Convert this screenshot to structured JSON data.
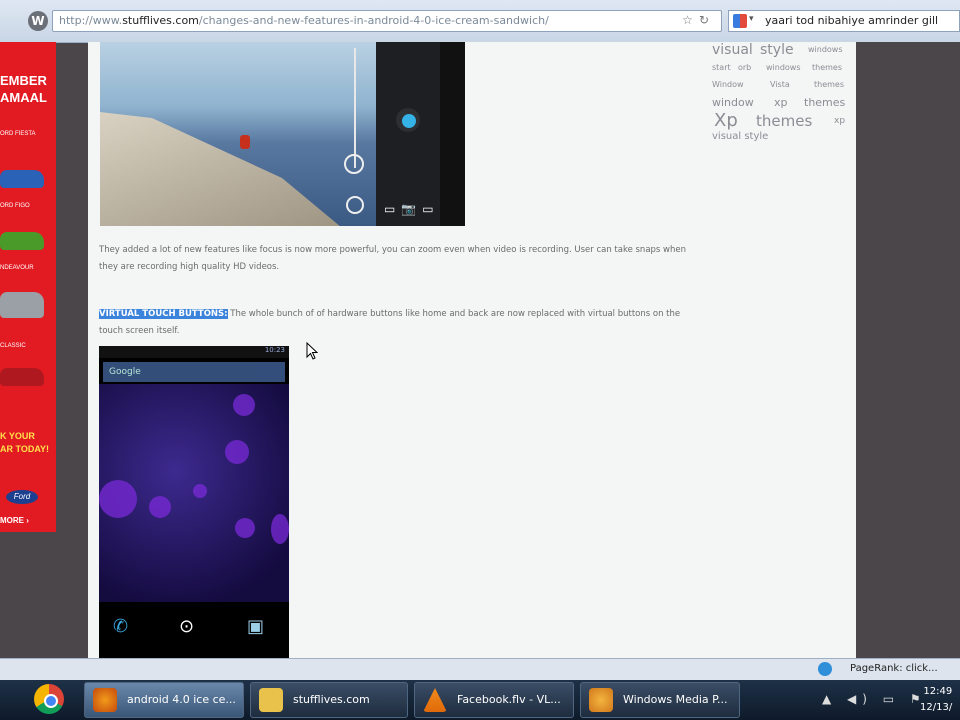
{
  "browser": {
    "url_prefix": "http://www.",
    "url_domain": "stufflives.com",
    "url_path": "/changes-and-new-features-in-android-4-0-ice-cream-sandwich/",
    "search_query": "yaari tod nibahiye amrinder gill"
  },
  "left_ad": {
    "headline_1": "EMBER",
    "headline_2": "AMAAL",
    "model_1": "ORD FIESTA",
    "model_2": "ORD FIGO",
    "model_3": "NDEAVOUR",
    "model_4": "CLASSIC",
    "cta_1": "K YOUR",
    "cta_2": "AR TODAY!",
    "logo": "Ford",
    "more": "MORE ›"
  },
  "article": {
    "para_1": "They added a lot of new features like focus is now more powerful, you can zoom even when video is recording. User can take snaps when they are recording high quality HD videos.",
    "highlight_label": "VIRTUAL TOUCH BUTTONS:",
    "para_2": " The whole bunch of of hardware buttons like home and back are now replaced with virtual buttons on the touch screen itself.",
    "phone_search": "Google",
    "phone_time": "10:23"
  },
  "tag_cloud": {
    "t1": "visual",
    "t2": "style",
    "t3": "windows",
    "t4": "start",
    "t5": "orb",
    "t6": "windows",
    "t7": "themes",
    "t8": "Window",
    "t9": "Vista",
    "t10": "themes",
    "t11": "window",
    "t12": "xp",
    "t13": "themes",
    "t14": "Xp",
    "t15": "themes",
    "t16": "xp",
    "t17": "visual style"
  },
  "status_bar": {
    "pagerank": "PageRank: click..."
  },
  "taskbar": {
    "task_1": "android 4.0 ice ce...",
    "task_2": "stufflives.com",
    "task_3": "Facebook.flv - VL...",
    "task_4": "Windows Media P...",
    "time": "12:49",
    "date": "12/13/"
  }
}
